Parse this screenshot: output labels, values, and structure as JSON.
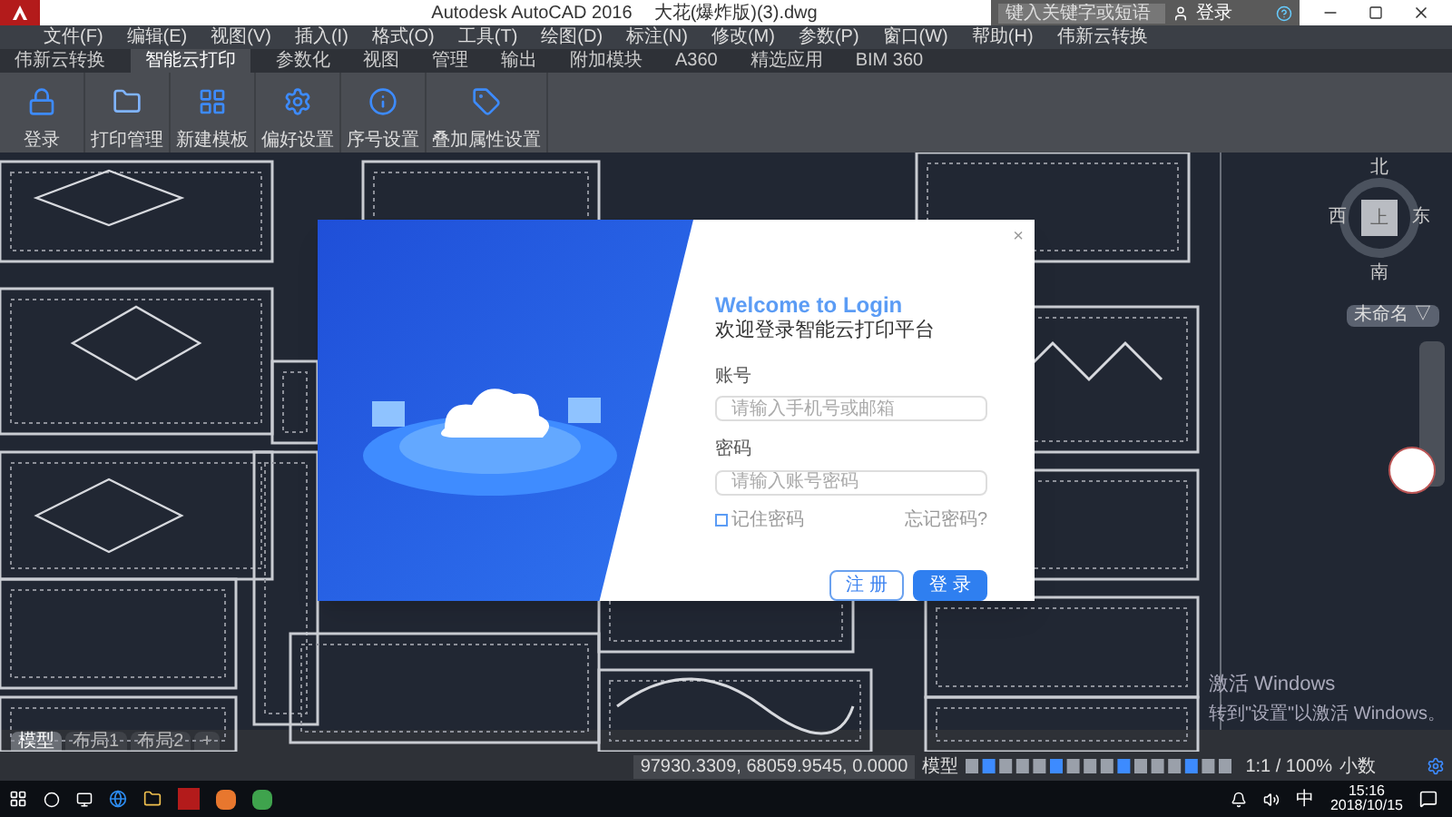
{
  "title_bar": {
    "title": "Autodesk AutoCAD 2016",
    "file": "大花(爆炸版)(3).dwg",
    "search": {
      "placeholder": "键入关键字或短语"
    },
    "sign_in": "登录"
  },
  "menu_bar": [
    "文件(F)",
    "编辑(E)",
    "视图(V)",
    "插入(I)",
    "格式(O)",
    "工具(T)",
    "绘图(D)",
    "标注(N)",
    "修改(M)",
    "参数(P)",
    "窗口(W)",
    "帮助(H)",
    "伟新云转换"
  ],
  "ribbon_tabs": [
    {
      "label": "伟新云转换",
      "selected": false
    },
    {
      "label": "智能云打印",
      "selected": true
    },
    {
      "label": "参数化",
      "selected": false
    },
    {
      "label": "视图",
      "selected": false
    },
    {
      "label": "管理",
      "selected": false
    },
    {
      "label": "输出",
      "selected": false
    },
    {
      "label": "附加模块",
      "selected": false
    },
    {
      "label": "A360",
      "selected": false
    },
    {
      "label": "精选应用",
      "selected": false
    },
    {
      "label": "BIM 360",
      "selected": false
    }
  ],
  "ribbon_buttons": [
    {
      "kind": "lock",
      "label": "登录"
    },
    {
      "kind": "folder",
      "label": "打印管理"
    },
    {
      "kind": "template",
      "label": "新建模板"
    },
    {
      "kind": "gear",
      "label": "偏好设置"
    },
    {
      "kind": "info",
      "label": "序号设置"
    },
    {
      "kind": "tag",
      "label": "叠加属性设置"
    }
  ],
  "viewcube": {
    "north": "北",
    "south": "南",
    "west": "西",
    "east": "东",
    "top": "上",
    "ucs": "未命名 ▽"
  },
  "login_dialog": {
    "close": "×",
    "heading": "Welcome to Login",
    "subheading": "欢迎登录智能云打印平台",
    "account_label": "账号",
    "account": {
      "placeholder": "请输入手机号或邮箱"
    },
    "password_label": "密码",
    "password": {
      "placeholder": "请输入账号密码"
    },
    "remember": {
      "label": "记住密码",
      "checked": false
    },
    "forgot": "忘记密码?",
    "register": "注 册",
    "login": "登 录"
  },
  "activation": {
    "title": "激活 Windows",
    "hint": "转到\"设置\"以激活 Windows。"
  },
  "layout_tabs": [
    {
      "label": "模型",
      "selected": true
    },
    {
      "label": "布局1",
      "selected": false
    },
    {
      "label": "布局2",
      "selected": false
    },
    {
      "label": "+",
      "selected": false
    }
  ],
  "status_bar": {
    "coordinates": "97930.3309, 68059.9545, 0.0000",
    "space": "模型",
    "scale": "1:1 / 100%",
    "units": "小数"
  },
  "taskbar": {
    "ime": "中",
    "time": "15:16",
    "date": "2018/10/15"
  }
}
